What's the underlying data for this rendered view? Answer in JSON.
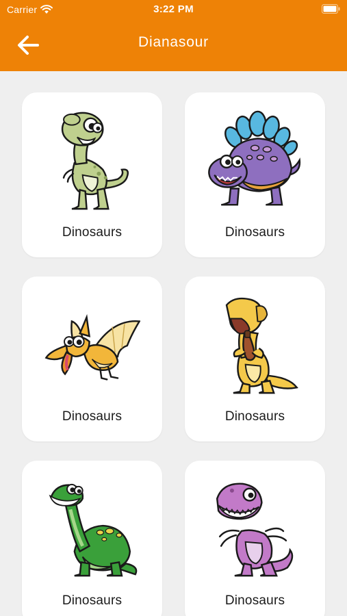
{
  "status_bar": {
    "carrier": "Carrier",
    "time": "3:22 PM",
    "icons": [
      "wifi-icon",
      "battery-icon"
    ]
  },
  "nav": {
    "title": "Dianasour",
    "back_icon": "arrow-left-icon"
  },
  "colors": {
    "accent": "#ee8206",
    "background": "#efefef",
    "card": "#ffffff",
    "text": "#1a1a1a"
  },
  "cards": [
    {
      "label": "Dinosaurs",
      "art": "green-trex-illustration"
    },
    {
      "label": "Dinosaurs",
      "art": "purple-stegosaurus-illustration"
    },
    {
      "label": "Dinosaurs",
      "art": "yellow-pterodactyl-illustration"
    },
    {
      "label": "Dinosaurs",
      "art": "yellow-trex-illustration"
    },
    {
      "label": "Dinosaurs",
      "art": "green-brachiosaurus-illustration"
    },
    {
      "label": "Dinosaurs",
      "art": "pink-trex-illustration"
    }
  ]
}
